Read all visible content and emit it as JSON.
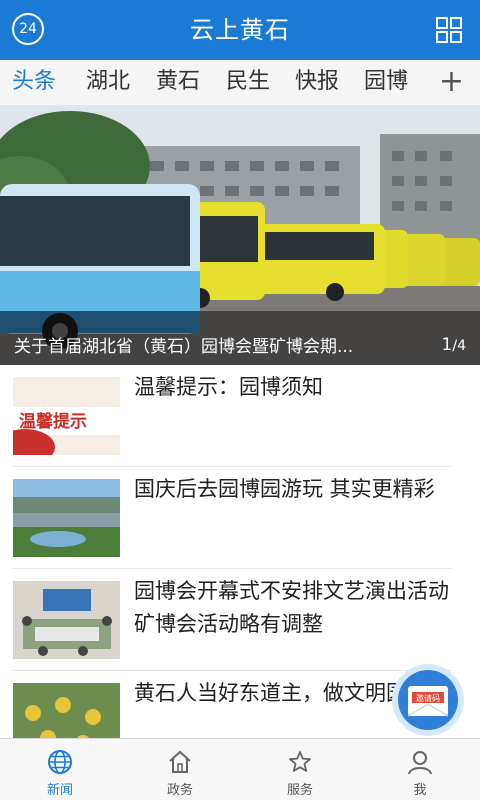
{
  "header": {
    "badge": "24",
    "title": "云上黄石"
  },
  "tabs": [
    {
      "label": "头条",
      "active": true
    },
    {
      "label": "湖北",
      "active": false
    },
    {
      "label": "黄石",
      "active": false
    },
    {
      "label": "民生",
      "active": false
    },
    {
      "label": "快报",
      "active": false
    },
    {
      "label": "园博",
      "active": false
    }
  ],
  "tab_add": "+",
  "banner": {
    "caption": "关于首届湖北省（黄石）园博会暨矿博会期...",
    "page_current": "1",
    "page_total": "4"
  },
  "news": [
    {
      "title": "温馨提示：园博须知",
      "thumb_text": "温馨提示"
    },
    {
      "title": "国庆后去园博园游玩 其实更精彩"
    },
    {
      "title": "园博会开幕式不安排文艺演出活动 矿博会活动略有调整"
    },
    {
      "title": "黄石人当好东道主，做文明园人"
    }
  ],
  "invite": {
    "label": "邀请码"
  },
  "bottom_nav": [
    {
      "label": "新闻",
      "icon": "globe-icon",
      "active": true
    },
    {
      "label": "政务",
      "icon": "home-icon",
      "active": false
    },
    {
      "label": "服务",
      "icon": "star-icon",
      "active": false
    },
    {
      "label": "我",
      "icon": "user-icon",
      "active": false
    }
  ],
  "colors": {
    "primary": "#1b7ad4",
    "tabs_bg": "#f5f5f5"
  }
}
